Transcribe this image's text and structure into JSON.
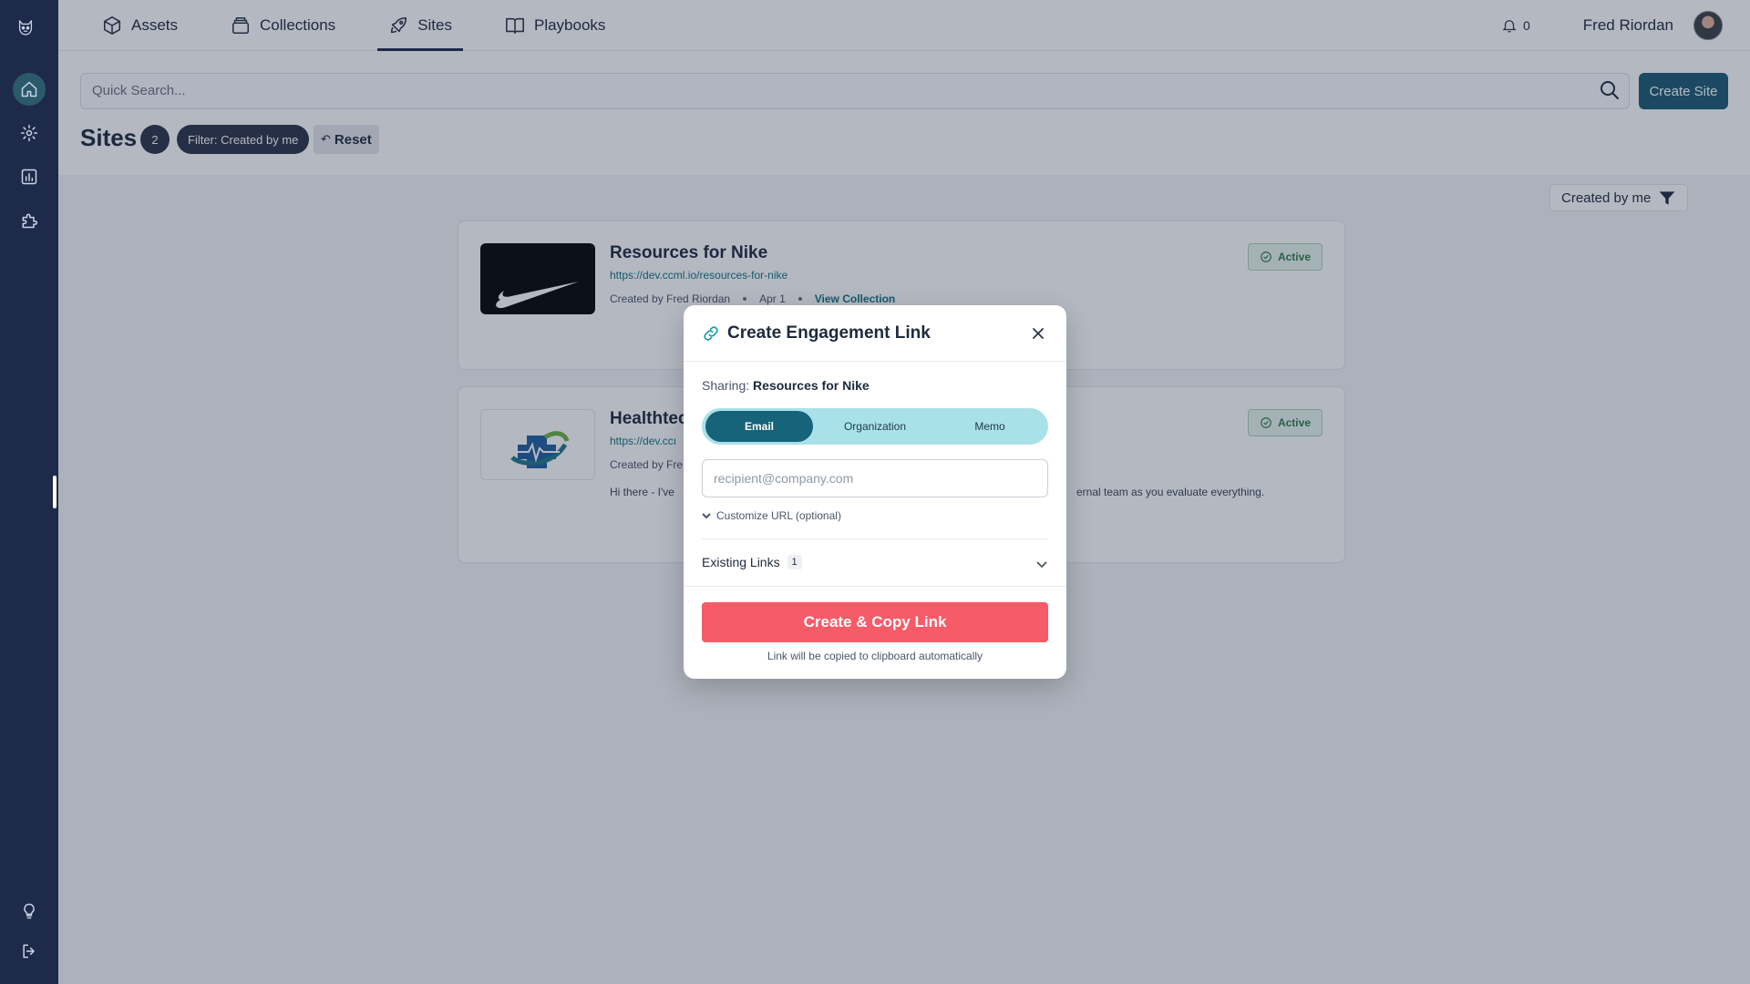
{
  "nav": {
    "tabs": [
      {
        "label": "Assets",
        "icon": "cube-icon"
      },
      {
        "label": "Collections",
        "icon": "stack-icon"
      },
      {
        "label": "Sites",
        "icon": "rocket-icon"
      },
      {
        "label": "Playbooks",
        "icon": "book-icon"
      }
    ],
    "active_tab": "Sites",
    "notifications_count": "0",
    "user_name": "Fred Riordan"
  },
  "rail": {
    "items": [
      "home-icon",
      "gear-icon",
      "chart-icon",
      "puzzle-icon"
    ],
    "bottom_items": [
      "lightbulb-icon",
      "logout-icon"
    ]
  },
  "search": {
    "placeholder": "Quick Search...",
    "create_label": "Create Site"
  },
  "page": {
    "title": "Sites",
    "count": "2",
    "filter_chip": "Filter: Created by me",
    "reset_label": "Reset",
    "sort_label": "Created by me"
  },
  "sites": [
    {
      "title": "Resources for Nike",
      "url": "https://dev.ccml.io/resources-for-nike",
      "created_by": "Created by Fred Riordan",
      "date": "Apr 1",
      "link_label": "View Collection",
      "status": "Active"
    },
    {
      "title": "Healthtec",
      "url": "https://dev.ccı",
      "created_by": "Created by Fre",
      "description_start": "Hi there - I've",
      "description_end": "ernal team as you evaluate everything.",
      "status": "Active"
    }
  ],
  "modal": {
    "title": "Create Engagement Link",
    "sharing_label": "Sharing:",
    "sharing_value": "Resources for Nike",
    "segments": [
      "Email",
      "Organization",
      "Memo"
    ],
    "active_segment": "Email",
    "email_placeholder": "recipient@company.com",
    "customize_label": "Customize URL (optional)",
    "existing_label": "Existing Links",
    "existing_count": "1",
    "cta_label": "Create & Copy Link",
    "hint": "Link will be copied to clipboard automatically"
  },
  "colors": {
    "rail": "#1e2a4a",
    "accent": "#16637a",
    "cta": "#f65b68",
    "segment_bg": "#a9e1e8",
    "active_green": "#2f7d4e"
  }
}
